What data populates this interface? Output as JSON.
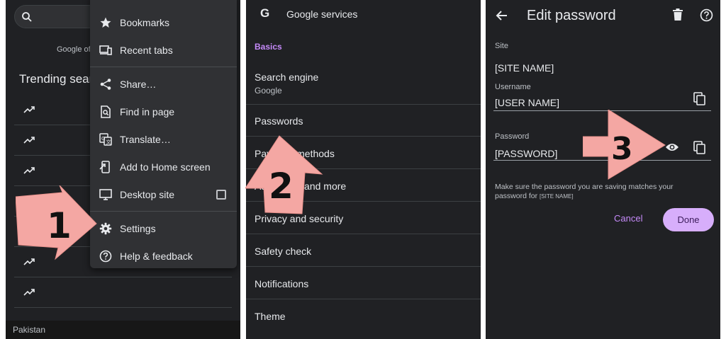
{
  "panel1": {
    "google_offered": "Google of",
    "trending_title": "Trending sear",
    "trends": [
      {
        "text": ""
      },
      {
        "text": ""
      },
      {
        "text": ""
      },
      {
        "text": ""
      },
      {
        "text": ""
      },
      {
        "text": ""
      },
      {
        "text": ""
      }
    ],
    "location": "Pakistan",
    "menu": {
      "items": [
        {
          "label": "Bookmarks",
          "icon": "star-icon"
        },
        {
          "label": "Recent tabs",
          "icon": "devices-icon"
        },
        {
          "label": "Share…",
          "icon": "share-icon"
        },
        {
          "label": "Find in page",
          "icon": "find-in-page-icon"
        },
        {
          "label": "Translate…",
          "icon": "translate-icon"
        },
        {
          "label": "Add to Home screen",
          "icon": "add-to-home-icon"
        },
        {
          "label": "Desktop site",
          "icon": "desktop-icon"
        },
        {
          "label": "Settings",
          "icon": "gear-icon"
        },
        {
          "label": "Help & feedback",
          "icon": "help-icon"
        }
      ]
    },
    "step_label": "1"
  },
  "panel2": {
    "logo": "G",
    "title": "Google services",
    "section": "Basics",
    "items": [
      {
        "title": "Search engine",
        "subtitle": "Google"
      },
      {
        "title": "Passwords"
      },
      {
        "title": "Payment methods"
      },
      {
        "title": "Addresses and more"
      },
      {
        "title": "Privacy and security"
      },
      {
        "title": "Safety check"
      },
      {
        "title": "Notifications"
      },
      {
        "title": "Theme"
      }
    ],
    "step_label": "2"
  },
  "panel3": {
    "title": "Edit password",
    "site_label": "Site",
    "site_value": "[SITE NAME]",
    "username_label": "Username",
    "username_value": "[USER NAME]",
    "password_label": "Password",
    "password_value": "[PASSWORD]",
    "note_text": "Make sure the password you are saving matches your password for",
    "note_site": "[SITE NAME]",
    "cancel_label": "Cancel",
    "done_label": "Done",
    "step_label": "3"
  },
  "colors": {
    "background": "#202124",
    "accent": "#c58af9",
    "done_button": "#d7aefb",
    "arrow": "#f4a7a3"
  }
}
